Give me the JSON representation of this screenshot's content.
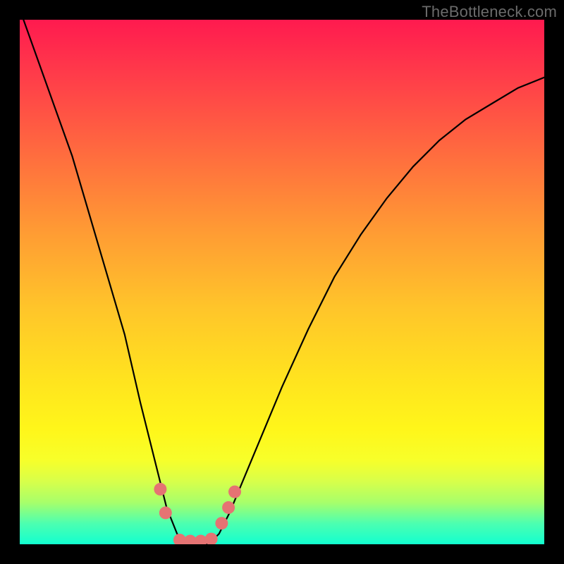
{
  "watermark": "TheBottleneck.com",
  "chart_data": {
    "type": "line",
    "title": "",
    "xlabel": "",
    "ylabel": "",
    "xlim": [
      0,
      100
    ],
    "ylim": [
      0,
      100
    ],
    "curve": {
      "name": "bottleneck-curve",
      "x": [
        0,
        5,
        10,
        15,
        20,
        23,
        26,
        28,
        30,
        32,
        34,
        36,
        38,
        40,
        45,
        50,
        55,
        60,
        65,
        70,
        75,
        80,
        85,
        90,
        95,
        100
      ],
      "y": [
        102,
        88,
        74,
        57,
        40,
        27,
        15,
        7,
        2,
        0,
        0,
        0,
        2,
        6,
        18,
        30,
        41,
        51,
        59,
        66,
        72,
        77,
        81,
        84,
        87,
        89
      ]
    },
    "markers": {
      "name": "highlight-points",
      "color": "#e57373",
      "points": [
        {
          "x": 26.8,
          "y": 10.5
        },
        {
          "x": 27.8,
          "y": 6.0
        },
        {
          "x": 30.5,
          "y": 0.8
        },
        {
          "x": 32.5,
          "y": 0.6
        },
        {
          "x": 34.5,
          "y": 0.6
        },
        {
          "x": 36.5,
          "y": 1.0
        },
        {
          "x": 38.5,
          "y": 4.0
        },
        {
          "x": 39.8,
          "y": 7.0
        },
        {
          "x": 41.0,
          "y": 10.0
        }
      ]
    },
    "gradient_stops": [
      {
        "pos": 0,
        "color": "#ff1a4f"
      },
      {
        "pos": 25,
        "color": "#ff6a3f"
      },
      {
        "pos": 55,
        "color": "#ffc52a"
      },
      {
        "pos": 78,
        "color": "#fff61a"
      },
      {
        "pos": 92,
        "color": "#a8ff6a"
      },
      {
        "pos": 100,
        "color": "#12ffd0"
      }
    ]
  }
}
